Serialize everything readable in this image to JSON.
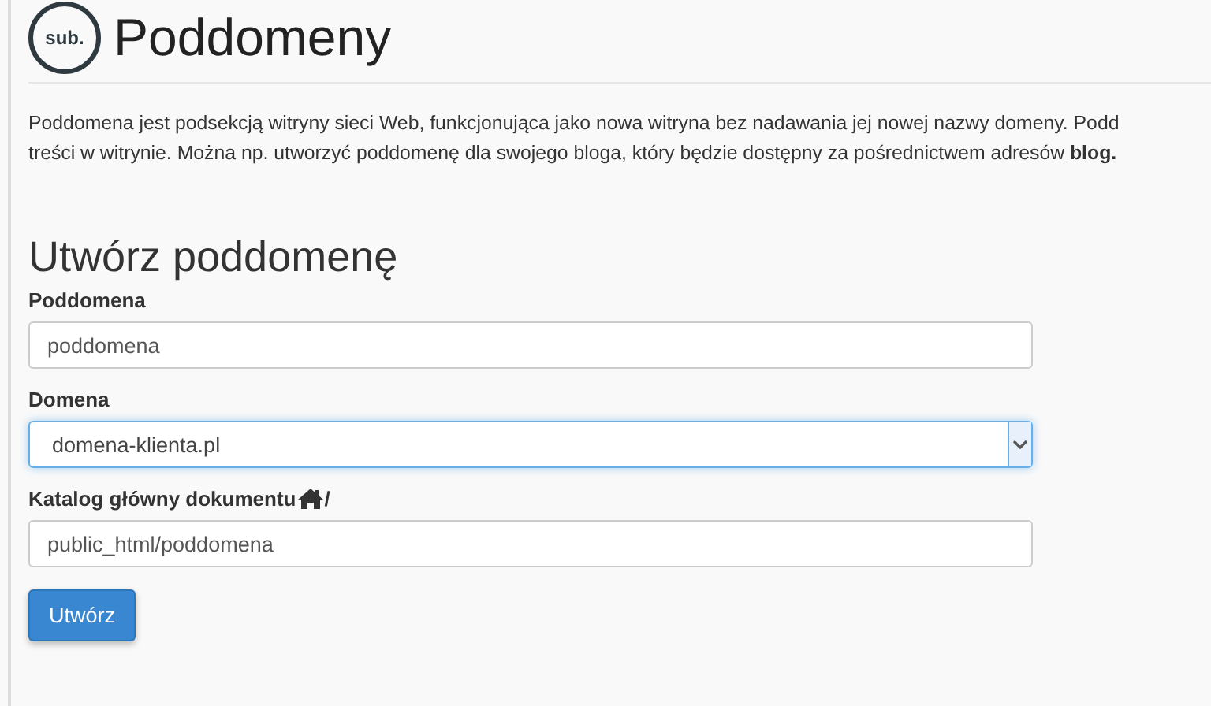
{
  "page": {
    "icon_text": "sub.",
    "title": "Poddomeny"
  },
  "description": [
    "Poddomena jest podsekcją witryny sieci Web, funkcjonująca jako nowa witryna bez nadawania jej nowej nazwy domeny. Podd",
    "treści w witrynie. Można np. utworzyć poddomenę dla swojego bloga, który będzie dostępny za pośrednictwem adresów **blog.**"
  ],
  "form": {
    "heading": "Utwórz poddomenę",
    "fields": [
      {
        "kind": "text",
        "label": "Poddomena",
        "value": "poddomena",
        "focused": false
      },
      {
        "kind": "select",
        "label": "Domena",
        "value": "domena-klienta.pl",
        "focused": true
      },
      {
        "kind": "text",
        "label": "Katalog główny dokumentu",
        "label_suffix": "/",
        "home_icon": true,
        "value": "public_html/poddomena",
        "focused": false
      }
    ],
    "submit": "Utwórz"
  }
}
